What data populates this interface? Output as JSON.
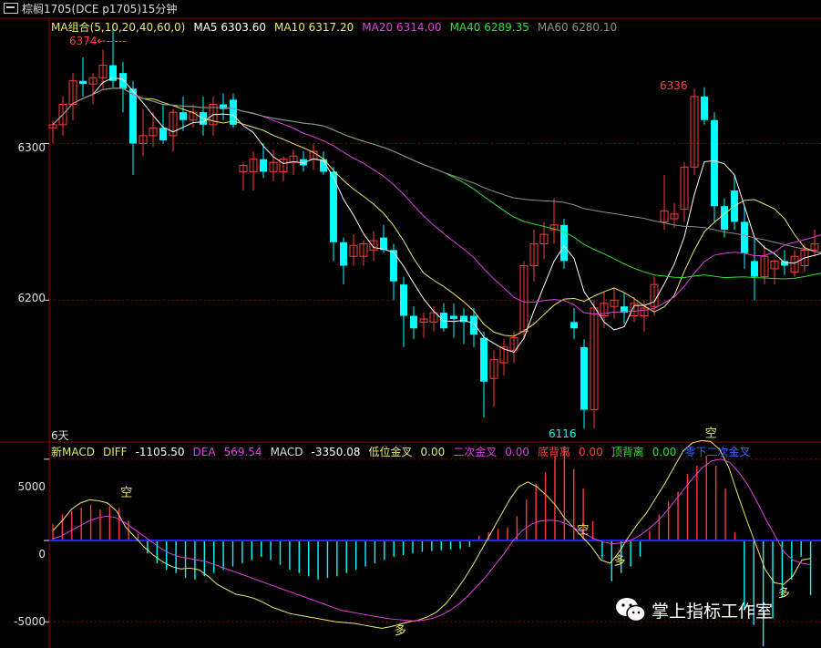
{
  "title": {
    "icon": "window-icon",
    "text": "棕榈1705(DCE p1705)15分钟"
  },
  "ma_legend": [
    {
      "key": "group",
      "label": "MA组合(5,10,20,40,60,0)",
      "color": "#e8e870"
    },
    {
      "key": "ma5",
      "label": "MA5 6303.60",
      "color": "#ffffff"
    },
    {
      "key": "ma10",
      "label": "MA10 6317.20",
      "color": "#e8e870"
    },
    {
      "key": "ma20",
      "label": "MA20 6314.00",
      "color": "#e040e0"
    },
    {
      "key": "ma40",
      "label": "MA40 6289.35",
      "color": "#30e030"
    },
    {
      "key": "ma60",
      "label": "MA60 6280.10",
      "color": "#909090"
    }
  ],
  "macd_legend": [
    {
      "label": "新MACD",
      "color": "#e8e870"
    },
    {
      "label": "DIFF",
      "color": "#e8e870"
    },
    {
      "label": "-1105.50",
      "color": "#ffffff"
    },
    {
      "label": "DEA",
      "color": "#e040e0"
    },
    {
      "label": "569.54",
      "color": "#e040e0"
    },
    {
      "label": "MACD",
      "color": "#dddddd"
    },
    {
      "label": "-3350.08",
      "color": "#ffffff"
    },
    {
      "label": "低位金叉",
      "color": "#e8e870"
    },
    {
      "label": "0.00",
      "color": "#e8e870"
    },
    {
      "label": "二次金叉",
      "color": "#e040e0"
    },
    {
      "label": "0.00",
      "color": "#e040e0"
    },
    {
      "label": "底背离",
      "color": "#ff4040"
    },
    {
      "label": "0.00",
      "color": "#ff4040"
    },
    {
      "label": "顶背离",
      "color": "#30e030"
    },
    {
      "label": "0.00",
      "color": "#30e030"
    },
    {
      "label": "零下二次金叉",
      "color": "#4060ff"
    }
  ],
  "price_axis_labels": [
    "6300",
    "6200"
  ],
  "macd_axis_labels": [
    "5000",
    "0",
    "-5000"
  ],
  "period_label": "6天",
  "high_marker": "6374",
  "high_arrow": "←-----",
  "peak_label": "6336",
  "low_label": "6116",
  "signal_labels": {
    "kong": "空",
    "duo": "多"
  },
  "watermark": "掌上指标工作室",
  "colors": {
    "up": "#ff3b3b",
    "down": "#00ffff",
    "ma5": "#ffffff",
    "ma10": "#e8e870",
    "ma20": "#e040e0",
    "ma40": "#30e030",
    "ma60": "#909090",
    "zero": "#2020ff",
    "grid": "#8b0000"
  },
  "chart_data": {
    "type": "candlestick",
    "ylim": [
      6110,
      6380
    ],
    "candles": [
      [
        6310,
        6315,
        6300,
        6312
      ],
      [
        6312,
        6330,
        6305,
        6325
      ],
      [
        6325,
        6345,
        6315,
        6340
      ],
      [
        6340,
        6355,
        6330,
        6338
      ],
      [
        6338,
        6345,
        6325,
        6342
      ],
      [
        6342,
        6360,
        6335,
        6350
      ],
      [
        6350,
        6374,
        6335,
        6340
      ],
      [
        6345,
        6352,
        6320,
        6335
      ],
      [
        6335,
        6340,
        6280,
        6300
      ],
      [
        6300,
        6322,
        6292,
        6305
      ],
      [
        6305,
        6320,
        6298,
        6310
      ],
      [
        6310,
        6325,
        6300,
        6302
      ],
      [
        6305,
        6322,
        6295,
        6320
      ],
      [
        6320,
        6330,
        6308,
        6315
      ],
      [
        6315,
        6325,
        6310,
        6320
      ],
      [
        6320,
        6330,
        6305,
        6312
      ],
      [
        6312,
        6330,
        6305,
        6325
      ],
      [
        6325,
        6332,
        6315,
        6322
      ],
      [
        6328,
        6332,
        6310,
        6312
      ],
      [
        6282,
        6288,
        6270,
        6286
      ],
      [
        6282,
        6295,
        6270,
        6290
      ],
      [
        6290,
        6300,
        6278,
        6282
      ],
      [
        6282,
        6296,
        6276,
        6288
      ],
      [
        6282,
        6292,
        6276,
        6290
      ],
      [
        6288,
        6296,
        6280,
        6292
      ],
      [
        6290,
        6295,
        6282,
        6286
      ],
      [
        6290,
        6300,
        6283,
        6295
      ],
      [
        6290,
        6295,
        6280,
        6282
      ],
      [
        6282,
        6285,
        6225,
        6237
      ],
      [
        6237,
        6240,
        6210,
        6222
      ],
      [
        6228,
        6242,
        6222,
        6235
      ],
      [
        6228,
        6238,
        6222,
        6236
      ],
      [
        6232,
        6244,
        6225,
        6238
      ],
      [
        6240,
        6248,
        6230,
        6232
      ],
      [
        6232,
        6236,
        6200,
        6212
      ],
      [
        6210,
        6215,
        6170,
        6190
      ],
      [
        6190,
        6196,
        6175,
        6182
      ],
      [
        6186,
        6192,
        6176,
        6188
      ],
      [
        6186,
        6196,
        6180,
        6192
      ],
      [
        6192,
        6198,
        6180,
        6182
      ],
      [
        6190,
        6198,
        6176,
        6188
      ],
      [
        6190,
        6195,
        6172,
        6186
      ],
      [
        6190,
        6195,
        6170,
        6178
      ],
      [
        6176,
        6180,
        6125,
        6148
      ],
      [
        6150,
        6168,
        6132,
        6162
      ],
      [
        6160,
        6175,
        6152,
        6170
      ],
      [
        6168,
        6180,
        6160,
        6176
      ],
      [
        6180,
        6225,
        6175,
        6222
      ],
      [
        6222,
        6245,
        6212,
        6236
      ],
      [
        6236,
        6250,
        6226,
        6242
      ],
      [
        6245,
        6265,
        6236,
        6248
      ],
      [
        6248,
        6252,
        6220,
        6225
      ],
      [
        6186,
        6195,
        6175,
        6182
      ],
      [
        6170,
        6175,
        6118,
        6130
      ],
      [
        6130,
        6200,
        6118,
        6195
      ],
      [
        6190,
        6205,
        6182,
        6198
      ],
      [
        6196,
        6208,
        6188,
        6200
      ],
      [
        6196,
        6205,
        6185,
        6192
      ],
      [
        6190,
        6202,
        6186,
        6198
      ],
      [
        6190,
        6200,
        6180,
        6195
      ],
      [
        6196,
        6215,
        6190,
        6210
      ],
      [
        6250,
        6280,
        6245,
        6257
      ],
      [
        6252,
        6262,
        6246,
        6255
      ],
      [
        6258,
        6288,
        6250,
        6285
      ],
      [
        6285,
        6335,
        6280,
        6330
      ],
      [
        6330,
        6336,
        6312,
        6315
      ],
      [
        6315,
        6320,
        6250,
        6260
      ],
      [
        6260,
        6265,
        6240,
        6245
      ],
      [
        6270,
        6280,
        6245,
        6250
      ],
      [
        6250,
        6260,
        6220,
        6230
      ],
      [
        6225,
        6240,
        6200,
        6215
      ],
      [
        6215,
        6235,
        6210,
        6228
      ],
      [
        6220,
        6226,
        6210,
        6225
      ],
      [
        6225,
        6232,
        6216,
        6222
      ],
      [
        6218,
        6232,
        6215,
        6228
      ],
      [
        6222,
        6236,
        6218,
        6232
      ],
      [
        6232,
        6245,
        6228,
        6236
      ],
      [
        6240,
        6245,
        6228,
        6234
      ],
      [
        6238,
        6258,
        6234,
        6252
      ],
      [
        6252,
        6275,
        6248,
        6262
      ]
    ],
    "macd": {
      "ylim": [
        -6500,
        6000
      ],
      "hist": [
        1000,
        1600,
        1800,
        2000,
        2200,
        1900,
        2100,
        2000,
        1200,
        400,
        -800,
        -1400,
        -1800,
        -2000,
        -2300,
        -2400,
        -2200,
        -2000,
        -1800,
        -1600,
        -1400,
        -1200,
        -1000,
        -1200,
        -1500,
        -1800,
        -2000,
        -2200,
        -2400,
        -2300,
        -2200,
        -2000,
        -1800,
        -1600,
        -1400,
        -1200,
        -1000,
        -900,
        -800,
        -700,
        -650,
        -600,
        -550,
        -500,
        -400,
        300,
        500,
        700,
        800,
        1500,
        2500,
        3500,
        4200,
        5200,
        5800,
        4400,
        3200,
        1200,
        -1100,
        -2500,
        -2000,
        -1600,
        -1000,
        600,
        1600,
        2400,
        3000,
        4100,
        4600,
        5200,
        4600,
        3200,
        500,
        -4200,
        -5200,
        -6500,
        -4800,
        -3500,
        -2400,
        -1000,
        -3350
      ],
      "diff": [
        600,
        1200,
        1900,
        2300,
        2500,
        2450,
        2300,
        1800,
        800,
        200,
        -400,
        -900,
        -1300,
        -1600,
        -1750,
        -1700,
        -1800,
        -2200,
        -2700,
        -3000,
        -3300,
        -3400,
        -3550,
        -3800,
        -4100,
        -4300,
        -4500,
        -4600,
        -4700,
        -4800,
        -4900,
        -5000,
        -5050,
        -5100,
        -5200,
        -5300,
        -5400,
        -5300,
        -5150,
        -5000,
        -4900,
        -4700,
        -4400,
        -3900,
        -3200,
        -2400,
        -1500,
        -500,
        500,
        1500,
        2500,
        3300,
        3600,
        3300,
        2800,
        2200,
        1400,
        800,
        200,
        -400,
        -1200,
        -1400,
        -700,
        200,
        1000,
        1700,
        2600,
        3500,
        4500,
        5500,
        6000,
        6150,
        6100,
        5600,
        4500,
        2800,
        1200,
        -300,
        -1800,
        -2600,
        -2700,
        -2200,
        -1200,
        -1100
      ],
      "dea": [
        100,
        300,
        600,
        900,
        1200,
        1400,
        1500,
        1400,
        1100,
        700,
        300,
        -100,
        -500,
        -800,
        -1000,
        -1100,
        -1200,
        -1300,
        -1500,
        -1700,
        -1900,
        -2100,
        -2300,
        -2500,
        -2700,
        -2900,
        -3100,
        -3300,
        -3500,
        -3700,
        -3900,
        -4100,
        -4300,
        -4400,
        -4500,
        -4600,
        -4700,
        -4800,
        -4850,
        -4900,
        -4950,
        -4900,
        -4800,
        -4600,
        -4300,
        -3900,
        -3400,
        -2800,
        -2200,
        -1500,
        -800,
        0,
        600,
        1000,
        1200,
        1250,
        1200,
        1000,
        700,
        400,
        100,
        -100,
        -200,
        -150,
        0,
        300,
        700,
        1200,
        1800,
        2500,
        3200,
        3900,
        4500,
        4900,
        5000,
        4800,
        4200,
        3400,
        2400,
        1300,
        300,
        -700,
        -1200,
        -1400,
        -1500
      ]
    },
    "signals": [
      {
        "type": "kong",
        "index": 8,
        "value": 2500
      },
      {
        "type": "duo",
        "index": 38,
        "value": -5000
      },
      {
        "type": "kong",
        "index": 58,
        "value": 200
      },
      {
        "type": "duo",
        "index": 62,
        "value": -700
      },
      {
        "type": "kong",
        "index": 72,
        "value": 6150
      },
      {
        "type": "duo",
        "index": 80,
        "value": -2700
      }
    ]
  }
}
